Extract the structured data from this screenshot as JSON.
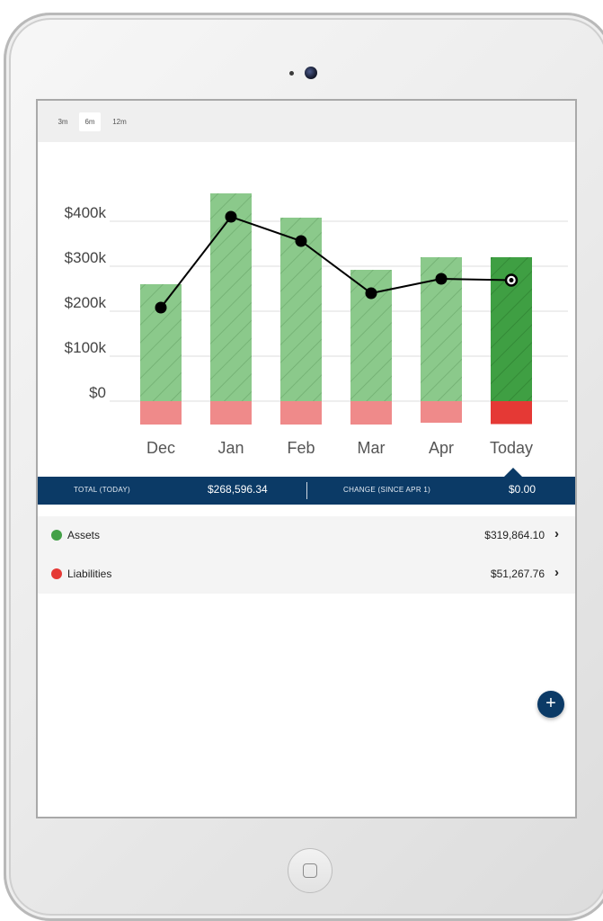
{
  "range_selector": {
    "options": [
      "3m",
      "6m",
      "12m"
    ],
    "selected": "6m"
  },
  "chart_data": {
    "type": "bar",
    "categories": [
      "Dec",
      "Jan",
      "Feb",
      "Mar",
      "Apr",
      "Today"
    ],
    "series": [
      {
        "values": [
          260,
          462,
          408,
          292,
          320,
          320
        ]
      },
      {
        "values": [
          -52,
          -52,
          -52,
          -52,
          -48,
          -51
        ]
      },
      {
        "values": [
          208,
          410,
          356,
          240,
          272,
          269
        ]
      }
    ],
    "y_ticks": [
      "$0",
      "$100k",
      "$200k",
      "$300k",
      "$400k"
    ],
    "y_tick_values": [
      0,
      100,
      200,
      300,
      400
    ],
    "ylim": [
      -60,
      470
    ],
    "grid": true,
    "colors": {
      "assets": "#8bc98b",
      "assets_today": "#3f9f43",
      "liabilities": "#ef8a8a",
      "liabilities_today": "#e53935",
      "line": "#000000"
    }
  },
  "summary": {
    "total_label": "TOTAL (TODAY)",
    "total_value": "$268,596.34",
    "change_label": "CHANGE (SINCE APR 1)",
    "change_value": "$0.00"
  },
  "list": {
    "items": [
      {
        "label": "Assets",
        "value": "$319,864.10",
        "chevron": "›",
        "dot_color": "#43a047"
      },
      {
        "label": "Liabilities",
        "value": "$51,267.76",
        "chevron": "›",
        "dot_color": "#e53935"
      }
    ]
  },
  "fab": {
    "label": "+"
  },
  "icons": {
    "fab": "plus-icon",
    "chevron": "chevron-right-icon",
    "home": "home-button-icon"
  },
  "theme": {
    "navy": "#0b3a66"
  }
}
